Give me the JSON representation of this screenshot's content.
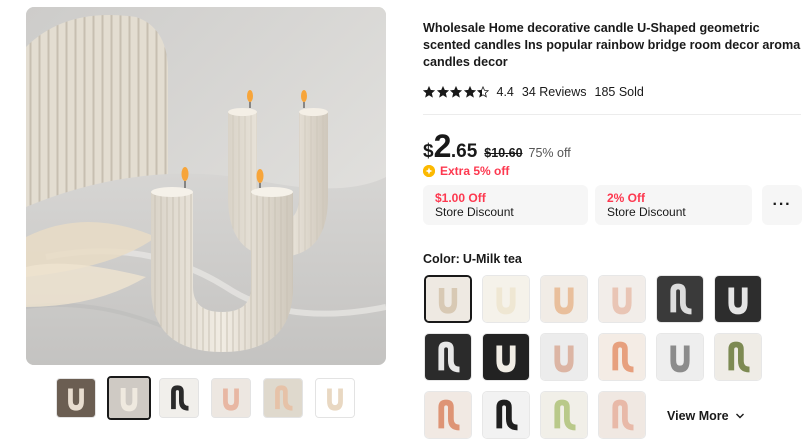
{
  "product": {
    "title": "Wholesale Home decorative candle U-Shaped geometric scented candles Ins popular rainbow bridge room decor aroma candles decor",
    "rating": "4.4",
    "rating_value": 4.4,
    "reviews": "34 Reviews",
    "sold": "185 Sold"
  },
  "price": {
    "currency": "$",
    "integer": "2",
    "decimal": ".65",
    "original": "$10.60",
    "discount": "75% off",
    "extra": "Extra 5% off"
  },
  "coupons": [
    {
      "amount": "$1.00 Off",
      "label": "Store Discount"
    },
    {
      "amount": "2% Off",
      "label": "Store Discount"
    }
  ],
  "coupons_more": "···",
  "color": {
    "label": "Color:",
    "selected": "U-Milk tea"
  },
  "swatches": [
    {
      "color": "#d8c9b4",
      "bg": "#eee9e2",
      "shape": "u"
    },
    {
      "color": "#efe7d3",
      "bg": "#f5f2ea",
      "shape": "u"
    },
    {
      "color": "#e9bf9c",
      "bg": "#f1ece6",
      "shape": "u"
    },
    {
      "color": "#e9c5b5",
      "bg": "#f2ede9",
      "shape": "u"
    },
    {
      "color": "#dcdcdc",
      "bg": "#3a3a3a",
      "shape": "s"
    },
    {
      "color": "#e5e5e5",
      "bg": "#2d2d2d",
      "shape": "u"
    },
    {
      "color": "#e8e8e8",
      "bg": "#2b2b2b",
      "shape": "s"
    },
    {
      "color": "#f1ede5",
      "bg": "#222222",
      "shape": "u"
    },
    {
      "color": "#dcb5a4",
      "bg": "#ececec",
      "shape": "u"
    },
    {
      "color": "#e7a07e",
      "bg": "#f4ece5",
      "shape": "s"
    },
    {
      "color": "#8c8c8c",
      "bg": "#eeeeee",
      "shape": "u"
    },
    {
      "color": "#7d8a53",
      "bg": "#efece6",
      "shape": "s"
    },
    {
      "color": "#de9475",
      "bg": "#f1e9e3",
      "shape": "s"
    },
    {
      "color": "#1f1f1f",
      "bg": "#f2f2f2",
      "shape": "s"
    },
    {
      "color": "#b9c98a",
      "bg": "#f1efe8",
      "shape": "s"
    },
    {
      "color": "#e8b9a8",
      "bg": "#f0e8e2",
      "shape": "s"
    }
  ],
  "view_more": "View More",
  "thumbnails": [
    {
      "bg": "#6b5e52",
      "color": "#e8ddcf"
    },
    {
      "bg": "#cfcac4",
      "color": "#efe9df"
    },
    {
      "bg": "#f1efeb",
      "color": "#2a2a2a"
    },
    {
      "bg": "#ede7e1",
      "color": "#e8b7a3"
    },
    {
      "bg": "#dfd9cd",
      "color": "#e6c2a8"
    },
    {
      "bg": "#ffffff",
      "color": "#e9d8c2"
    }
  ],
  "colors": {
    "accent": "#fd384f",
    "coin": "#fcb900",
    "text": "#191919"
  }
}
